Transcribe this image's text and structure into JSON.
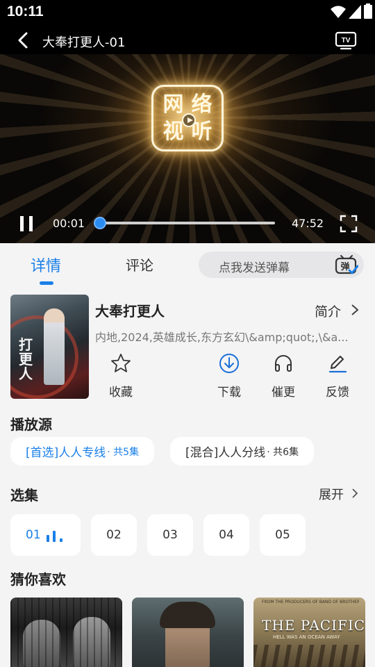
{
  "status_bar": {
    "time": "10:11"
  },
  "player": {
    "title": "大奉打更人-01",
    "current_time": "00:01",
    "total_time": "47:52",
    "progress_fraction": 0.0,
    "logo_chars": [
      "网",
      "络",
      "视",
      "听"
    ]
  },
  "tabs": [
    {
      "label": "详情",
      "active": true
    },
    {
      "label": "评论",
      "active": false
    }
  ],
  "danmaku": {
    "placeholder": "点我发送弹幕",
    "icon_char": "弹"
  },
  "show": {
    "poster_text": "打更人",
    "name": "大奉打更人",
    "intro_label": "简介",
    "meta": "内地,2024,英雄成长,东方玄幻\\&amp;quot;,\\&a..."
  },
  "actions": [
    {
      "label": "收藏",
      "icon": "star-icon"
    },
    {
      "label": "下载",
      "icon": "download-icon"
    },
    {
      "label": "催更",
      "icon": "headphones-icon"
    },
    {
      "label": "反馈",
      "icon": "edit-icon"
    }
  ],
  "sources": {
    "title": "播放源",
    "items": [
      {
        "label": "[首选]人人专线",
        "count": " · 共5集",
        "active": true
      },
      {
        "label": "[混合]人人分线",
        "count": " · 共6集",
        "active": false
      }
    ]
  },
  "episodes": {
    "title": "选集",
    "expand_label": "展开",
    "items": [
      "01",
      "02",
      "03",
      "04",
      "05"
    ],
    "active_index": 0
  },
  "recommendations": {
    "title": "猜你喜欢",
    "items": [
      {
        "name": "rec-poster-1"
      },
      {
        "name": "rec-poster-2"
      },
      {
        "name": "rec-poster-3",
        "top_text": "FROM THE PRODUCERS OF BAND OF BROTHERS",
        "title": "THE PACIFIC",
        "subtitle": "HELL WAS AN OCEAN AWAY"
      }
    ]
  },
  "colors": {
    "accent": "#1a7fe8",
    "background": "#f4f4f5",
    "card": "#ffffff"
  }
}
